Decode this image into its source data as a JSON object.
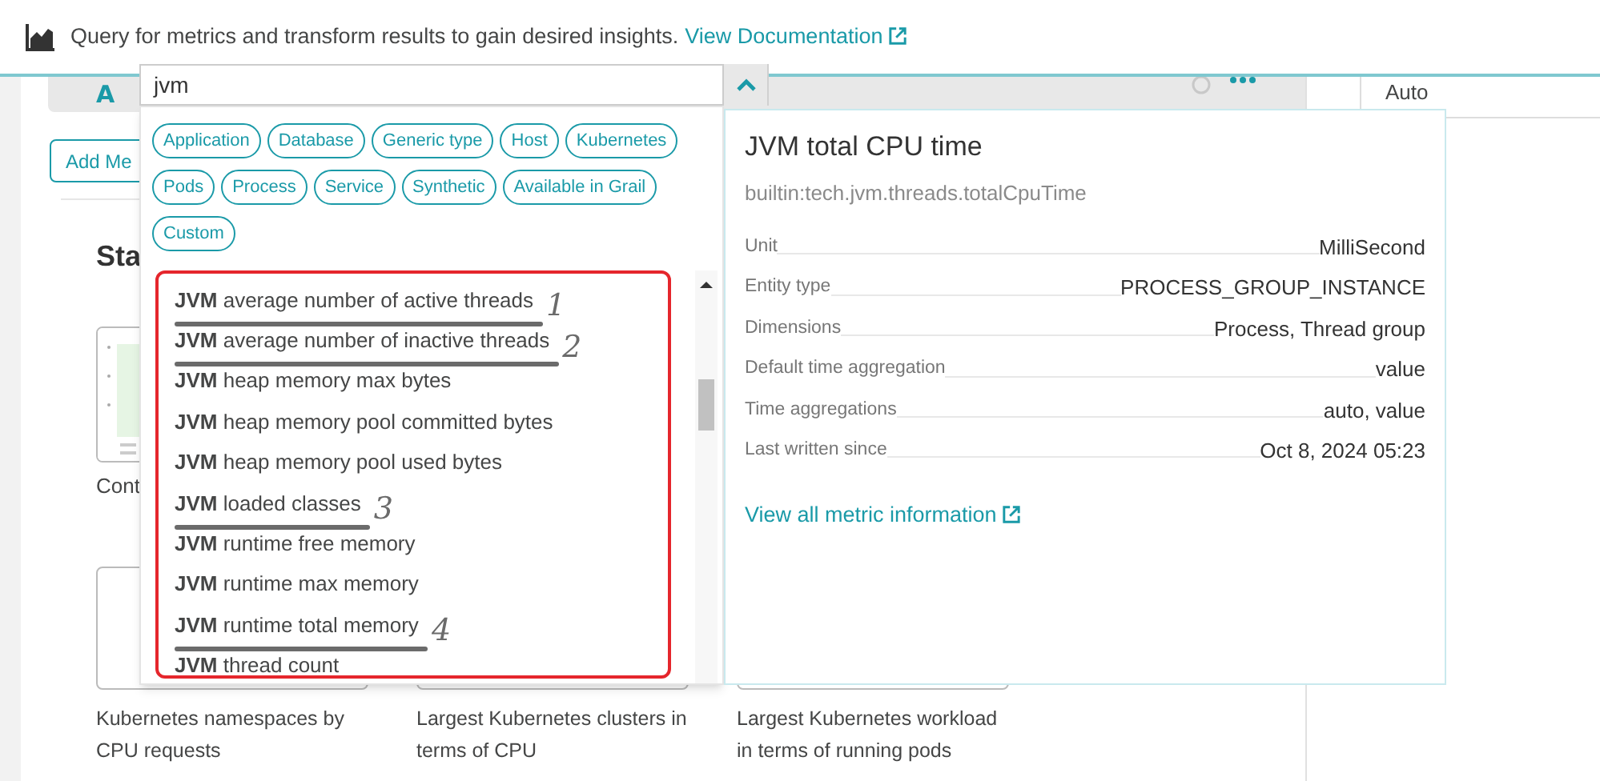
{
  "header": {
    "description": "Query for metrics and transform results to gain desired insights.",
    "link": "View Documentation"
  },
  "query": {
    "letter": "A",
    "value": "jvm"
  },
  "resolution": {
    "value": "Auto"
  },
  "background": {
    "add_button": "Add Me",
    "section_heading": "Sta",
    "partial_caption": "Cont",
    "cards": [
      {
        "caption": "Kubernetes namespaces by CPU requests"
      },
      {
        "caption": "Largest Kubernetes clusters in terms of CPU"
      },
      {
        "caption": "Largest Kubernetes workload in terms of running pods"
      }
    ]
  },
  "filters": [
    {
      "label": "Application"
    },
    {
      "label": "Database"
    },
    {
      "label": "Generic type"
    },
    {
      "label": "Host"
    },
    {
      "label": "Kubernetes"
    },
    {
      "label": "Pods"
    },
    {
      "label": "Process"
    },
    {
      "label": "Service"
    },
    {
      "label": "Synthetic"
    },
    {
      "label": "Available in Grail"
    },
    {
      "label": "Custom"
    }
  ],
  "metrics": [
    {
      "text": "**JVM** average number of active threads",
      "annotation": "1"
    },
    {
      "text": "**JVM** average number of inactive threads",
      "annotation": "2"
    },
    {
      "text": "**JVM** heap memory max bytes"
    },
    {
      "text": "**JVM** heap memory pool committed bytes"
    },
    {
      "text": "**JVM** heap memory pool used bytes"
    },
    {
      "text": "**JVM** loaded classes",
      "annotation": "3"
    },
    {
      "text": "**JVM** runtime free memory"
    },
    {
      "text": "**JVM** runtime max memory"
    },
    {
      "text": "**JVM** runtime total memory",
      "annotation": "4"
    },
    {
      "text": "**JVM** thread count"
    }
  ],
  "detail": {
    "title": "JVM total CPU time",
    "metric_key": "builtin:tech.jvm.threads.totalCpuTime",
    "properties": [
      {
        "label": "Unit",
        "value": "MilliSecond"
      },
      {
        "label": "Entity type",
        "value": "PROCESS_GROUP_INSTANCE"
      },
      {
        "label": "Dimensions",
        "value": "Process, Thread group"
      },
      {
        "label": "Default time aggregation",
        "value": "value"
      },
      {
        "label": "Time aggregations",
        "value": "auto, value"
      },
      {
        "label": "Last written since",
        "value": "Oct 8, 2024 05:23"
      }
    ],
    "link": "View all metric information"
  }
}
